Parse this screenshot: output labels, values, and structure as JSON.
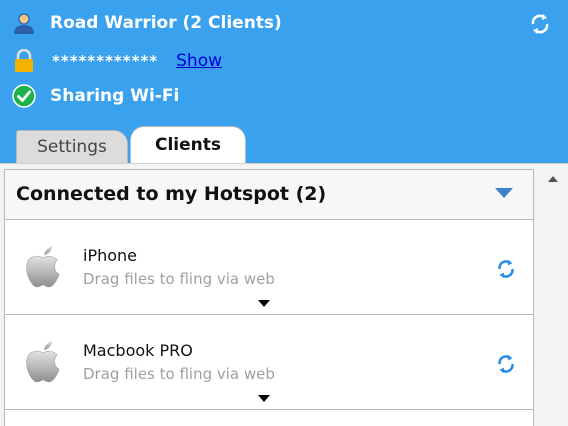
{
  "colors": {
    "header_bg": "#3aa1ef",
    "link": "#0000d0",
    "accent": "#3a7fd0",
    "success": "#1db34a",
    "lock": "#f5b400"
  },
  "header": {
    "title": "Road Warrior (2 Clients)",
    "password_mask": "************",
    "show_label": "Show",
    "status": "Sharing Wi-Fi",
    "icons": {
      "user": "user-icon",
      "lock": "lock-icon",
      "status": "check-circle-icon",
      "refresh": "refresh-icon"
    }
  },
  "tabs": [
    {
      "label": "Settings",
      "active": false
    },
    {
      "label": "Clients",
      "active": true
    }
  ],
  "group": {
    "title": "Connected to my Hotspot (2)"
  },
  "clients": [
    {
      "name": "iPhone",
      "subtitle": "Drag files to fling via web",
      "icon": "apple-icon"
    },
    {
      "name": "Macbook PRO",
      "subtitle": "Drag files to fling via web",
      "icon": "apple-icon"
    }
  ]
}
